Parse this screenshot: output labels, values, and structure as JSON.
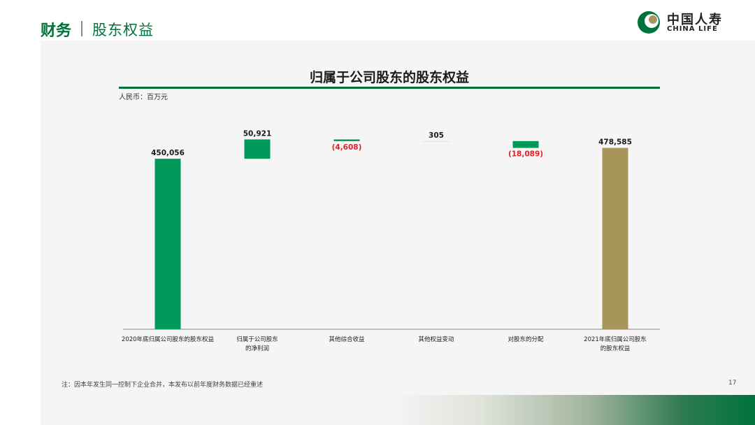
{
  "header": {
    "title": "财务",
    "subtitle": "股东权益"
  },
  "logo": {
    "cn": "中国人寿",
    "en": "CHINA LIFE"
  },
  "colors": {
    "accent": "#00733c",
    "bar_green": "#00995a",
    "bar_gold": "#a8955a",
    "negative_label": "#e0202a"
  },
  "chart_data": {
    "type": "waterfall",
    "title": "归属于公司股东的股东权益",
    "unit_label": "人民币：百万元",
    "ylim": [
      0,
      500000
    ],
    "categories": [
      {
        "lines": [
          "2020年底归属公司股东的股东权益"
        ]
      },
      {
        "lines": [
          "归属于公司股东",
          "的净利润"
        ]
      },
      {
        "lines": [
          "其他综合收益"
        ]
      },
      {
        "lines": [
          "其他权益变动"
        ]
      },
      {
        "lines": [
          "对股东的分配"
        ]
      },
      {
        "lines": [
          "2021年底归属公司股东",
          "的股东权益"
        ]
      }
    ],
    "values": [
      450056,
      50921,
      -4608,
      305,
      -18089,
      478585
    ],
    "value_labels": [
      "450,056",
      "50,921",
      "(4,608)",
      "305",
      "(18,089)",
      "478,585"
    ],
    "kinds": [
      "total",
      "delta",
      "delta",
      "delta",
      "delta",
      "total"
    ]
  },
  "footer": {
    "note": "注：因本年发生同一控制下企业合并，本发布以前年度财务数据已经重述",
    "page": "17"
  }
}
